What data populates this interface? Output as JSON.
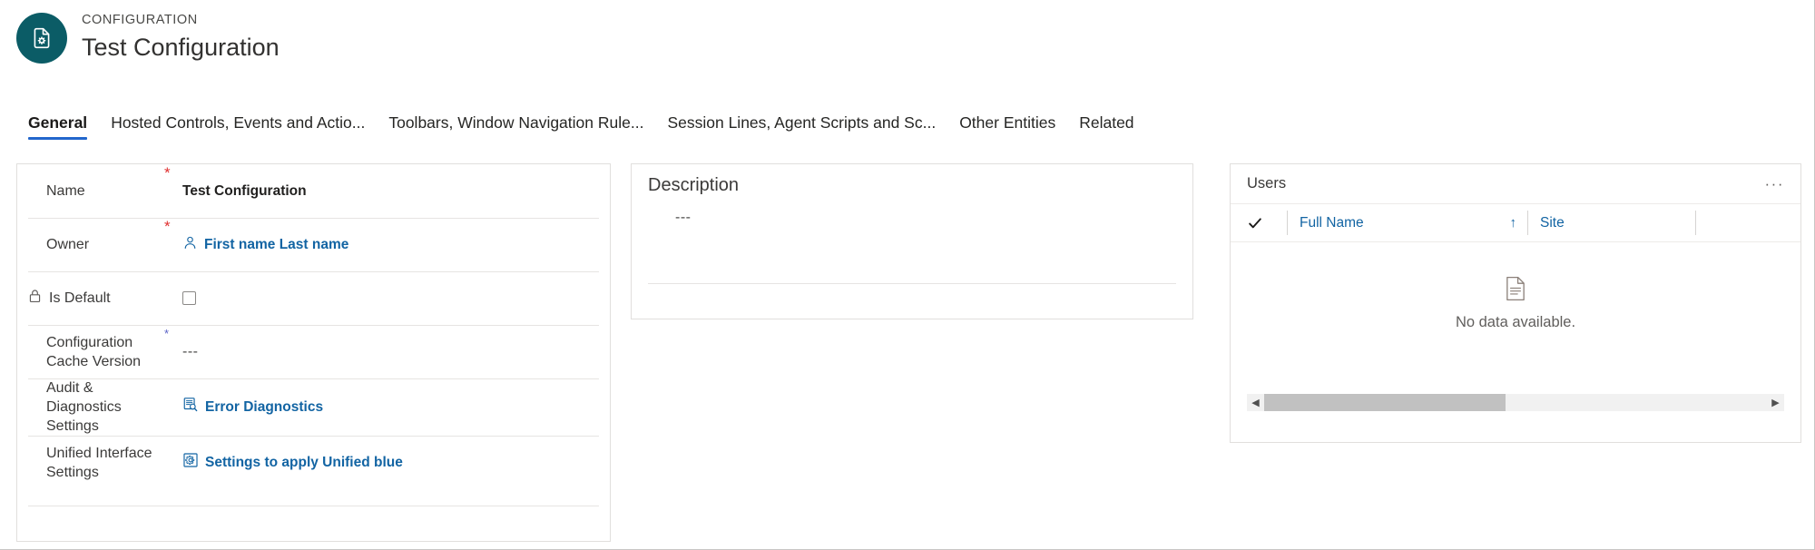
{
  "header": {
    "eyebrow": "CONFIGURATION",
    "title": "Test Configuration",
    "avatar_icon": "document-gear-icon",
    "avatar_color": "#0b5c66"
  },
  "tabs": [
    {
      "label": "General",
      "active": true
    },
    {
      "label": "Hosted Controls, Events and Actio...",
      "active": false
    },
    {
      "label": "Toolbars, Window Navigation Rule...",
      "active": false
    },
    {
      "label": "Session Lines, Agent Scripts and Sc...",
      "active": false
    },
    {
      "label": "Other Entities",
      "active": false
    },
    {
      "label": "Related",
      "active": false
    }
  ],
  "form": {
    "fields": [
      {
        "label": "Name",
        "required": "red",
        "value": "Test Configuration",
        "type": "text-bold"
      },
      {
        "label": "Owner",
        "required": "red",
        "value": "First name Last name",
        "type": "lookup",
        "icon": "person-icon"
      },
      {
        "label": "Is Default",
        "required": "none",
        "value": "",
        "type": "checkbox",
        "checked": false,
        "icon": "lock-icon"
      },
      {
        "label": "Configuration Cache Version",
        "required": "blue",
        "value": "---",
        "type": "text-muted"
      },
      {
        "label": "Audit & Diagnostics Settings",
        "required": "none",
        "value": "Error Diagnostics",
        "type": "link",
        "icon": "document-search-icon"
      },
      {
        "label": "Unified Interface Settings",
        "required": "none",
        "value": "Settings to apply Unified blue",
        "type": "link",
        "icon": "gear-box-icon"
      }
    ]
  },
  "description": {
    "title": "Description",
    "value": "---"
  },
  "users": {
    "title": "Users",
    "more_label": "···",
    "columns": [
      {
        "label": "Full Name",
        "sorted": true,
        "sort_dir": "↑"
      },
      {
        "label": "Site",
        "sorted": false,
        "sort_dir": ""
      }
    ],
    "select_all_icon": "checkmark-icon",
    "empty_icon": "empty-document-icon",
    "empty_text": "No data available.",
    "rows": [],
    "scrollbar": {
      "left_arrow": "◀",
      "right_arrow": "▶",
      "thumb_fraction": 0.48
    }
  },
  "colors": {
    "accent_tab": "#2266cc",
    "link": "#1264a3",
    "required_red": "#e03030",
    "required_blue": "#5b63c7",
    "teal": "#0b5c66"
  }
}
